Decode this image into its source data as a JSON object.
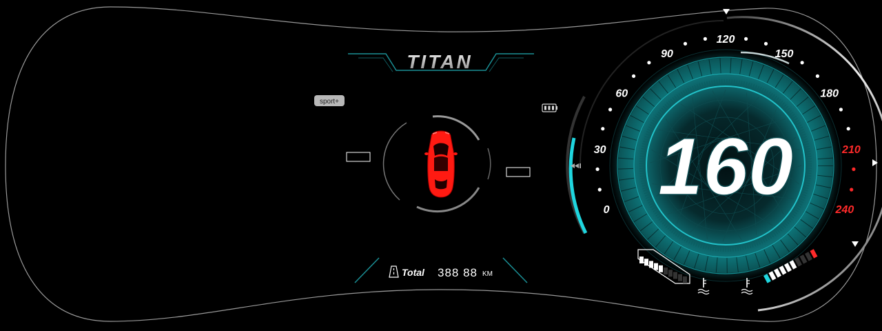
{
  "brand": {
    "name": "TITAN"
  },
  "drive_mode": {
    "label": "sport+"
  },
  "odometer": {
    "label": "Total",
    "value": "388 88",
    "unit": "KM"
  },
  "speedometer": {
    "speed": "160",
    "speed_value": 160,
    "max": 240,
    "ticks": [
      "0",
      "30",
      "60",
      "90",
      "120",
      "150",
      "180",
      "210",
      "240"
    ],
    "redline_from": 210
  },
  "battery": {
    "bars": 3
  },
  "fuel_gauge": {
    "filled_segments": 5,
    "total_segments": 10
  },
  "temp_gauge": {
    "filled_segments": 6,
    "total_segments": 10
  },
  "colors": {
    "accent": "#1fd6df",
    "teal_dark": "#0b4a4f",
    "danger": "#ff2a2a",
    "car_red": "#ff1a12",
    "tag_bg": "#b8b8b8"
  },
  "icons": {
    "odometer": "road-icon",
    "battery": "battery-icon",
    "coolant": "coolant-temp-icon",
    "car": "car-top-view-icon",
    "rewind": "double-arrow-left-icon"
  }
}
